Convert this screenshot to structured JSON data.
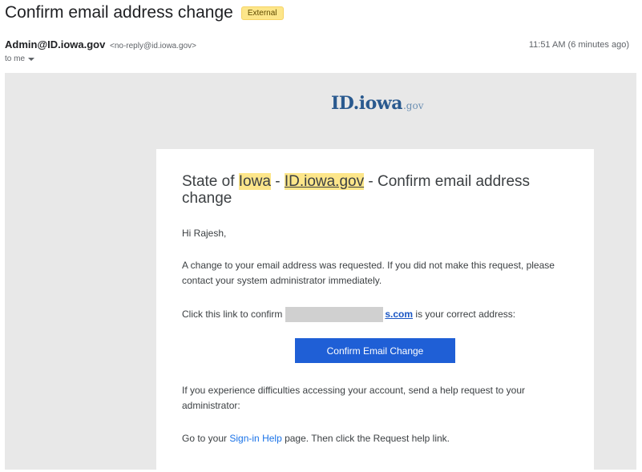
{
  "email": {
    "subject": "Confirm email address change",
    "badge": "External",
    "sender_name": "Admin@ID.iowa.gov",
    "sender_email": "<no-reply@id.iowa.gov>",
    "time": "11:51 AM (6 minutes ago)",
    "to": "to me"
  },
  "logo": {
    "text": "ID.iowa",
    "suffix": ".gov"
  },
  "body": {
    "title_part1": "State of ",
    "title_iowa": "Iowa",
    "title_dash1": " - ",
    "title_id": "ID.iowa.gov",
    "title_rest": " - Confirm email address change",
    "greeting": "Hi Rajesh,",
    "paragraph1": "A change to your email address was requested. If you did not make this request, please contact your system administrator immediately.",
    "confirm_prefix": "Click this link to confirm",
    "email_suffix": "s.com",
    "confirm_suffix": " is your correct address:",
    "button_label": "Confirm Email Change",
    "paragraph2": "If you experience difficulties accessing your account, send a help request to your administrator:",
    "help_prefix": "Go to your ",
    "help_link": "Sign-in Help",
    "help_suffix": " page. Then click the Request help link."
  },
  "colors": {
    "highlight": "#fde68a",
    "button": "#1f5fd6",
    "link": "#1a73e8"
  }
}
